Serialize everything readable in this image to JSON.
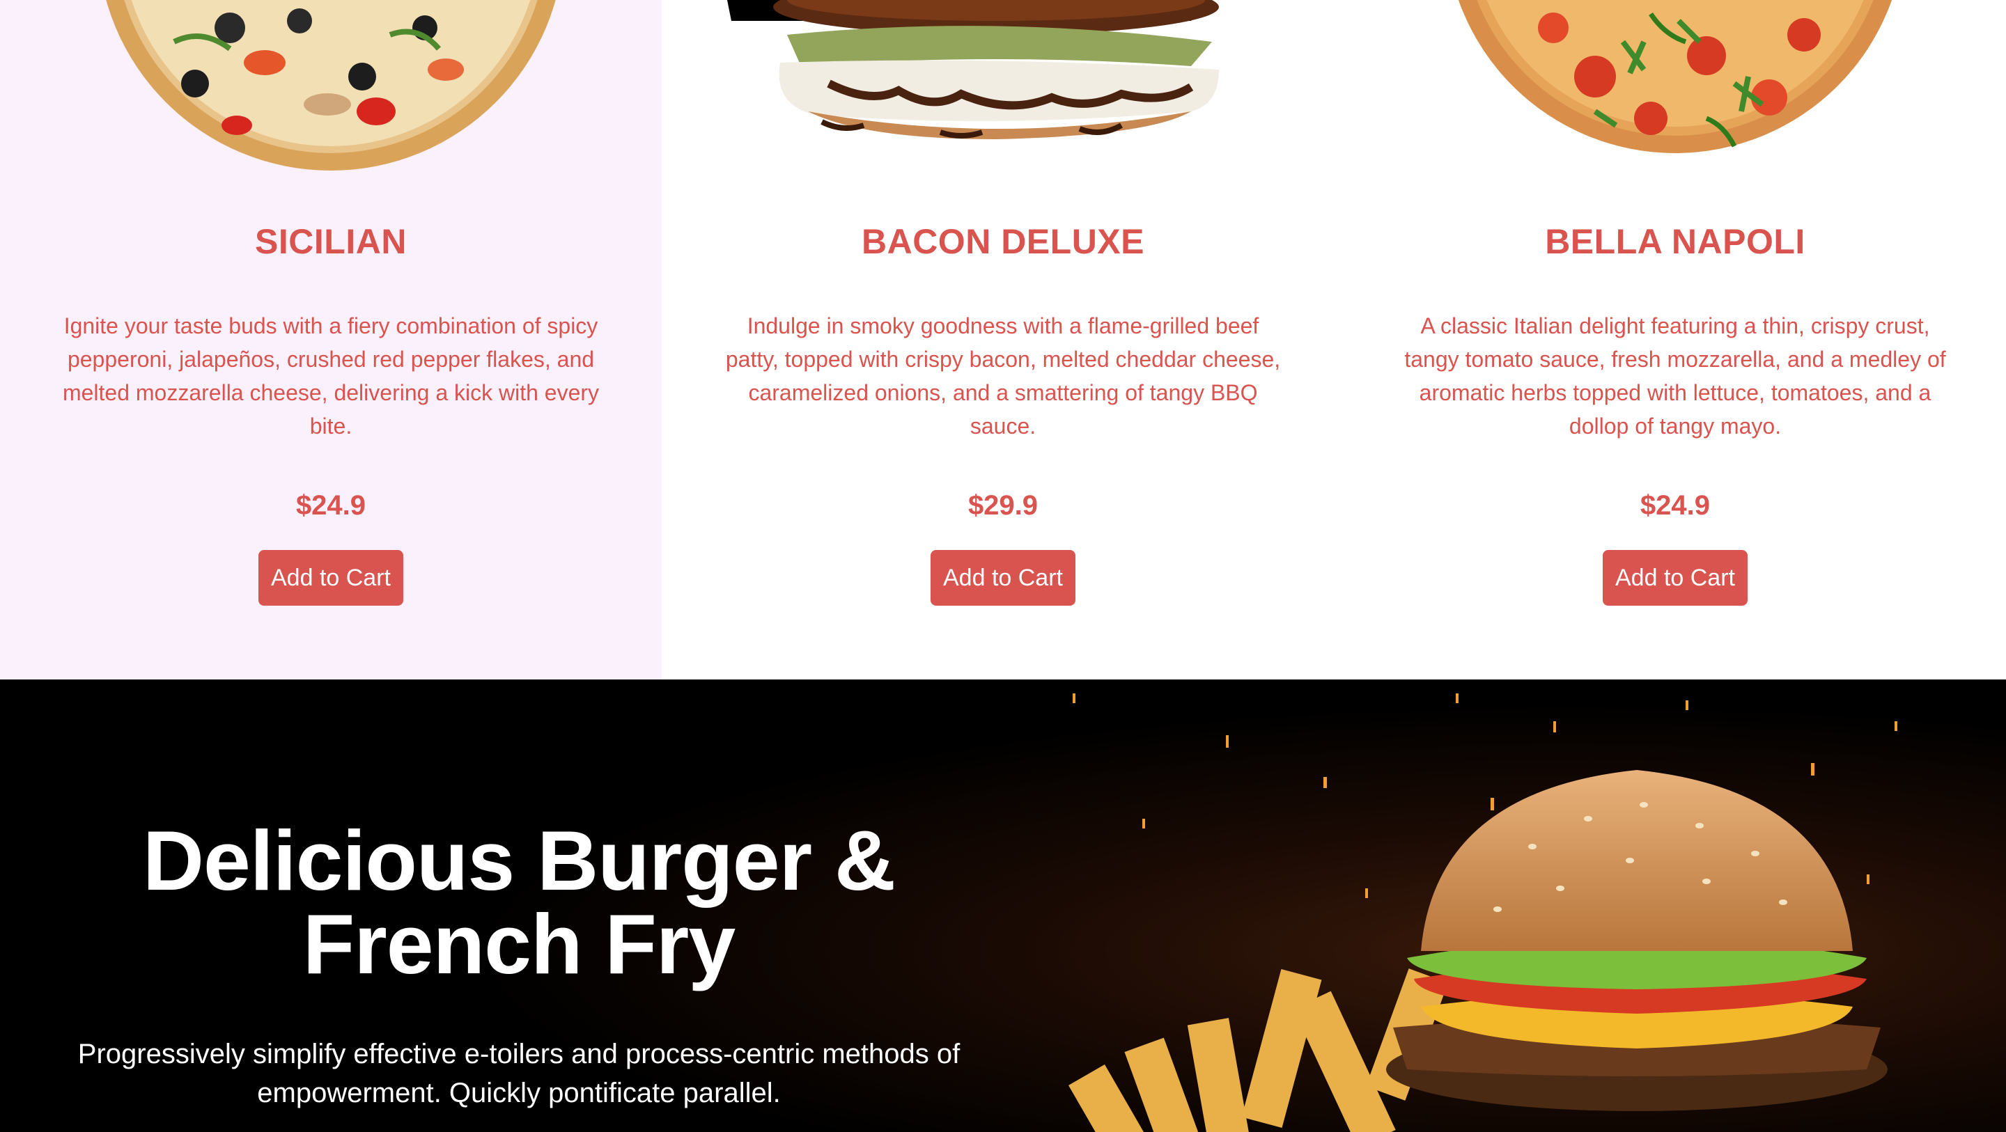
{
  "products": [
    {
      "name": "SICILIAN",
      "description": "Ignite your taste buds with a fiery combination of spicy pepperoni, jalapeños, crushed red pepper flakes, and melted mozzarella cheese, delivering a kick with every bite.",
      "price": "$24.9",
      "button_label": "Add to Cart",
      "image": "pizza-image"
    },
    {
      "name": "BACON DELUXE",
      "description": "Indulge in smoky goodness with a flame-grilled beef patty, topped with crispy bacon, melted cheddar cheese, caramelized onions, and a smattering of tangy BBQ sauce.",
      "price": "$29.9",
      "button_label": "Add to Cart",
      "image": "burger-image"
    },
    {
      "name": "BELLA NAPOLI",
      "description": "A classic Italian delight featuring a thin, crispy crust, tangy tomato sauce, fresh mozzarella, and a medley of aromatic herbs topped with lettuce, tomatoes, and a dollop of tangy mayo.",
      "price": "$24.9",
      "button_label": "Add to Cart",
      "image": "pizza-image"
    }
  ],
  "hero": {
    "title": "Delicious Burger & French Fry",
    "subtitle": "Progressively simplify effective e-toilers and process-centric methods of empowerment. Quickly pontificate parallel.",
    "image": "burger-and-fries-image"
  },
  "colors": {
    "accent": "#d9534f",
    "highlight_bg": "#fbf1fd",
    "hero_bg": "#000000",
    "hero_text": "#ffffff"
  }
}
